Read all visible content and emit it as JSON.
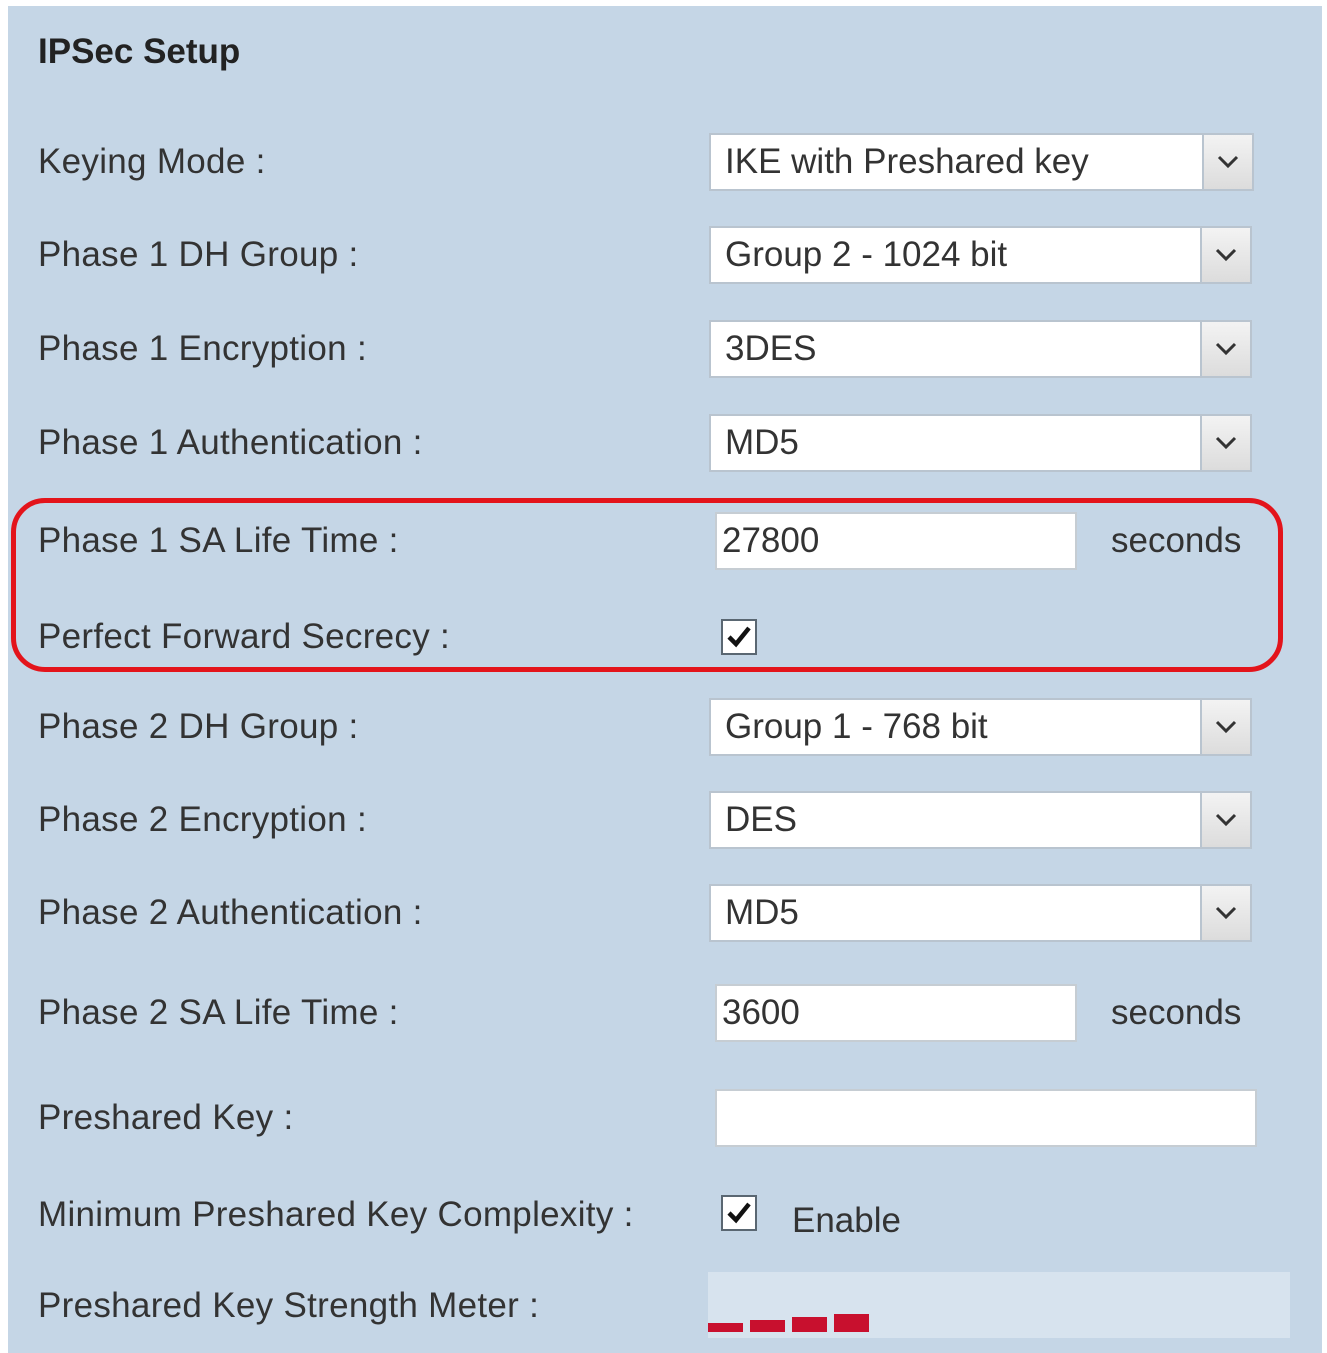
{
  "section_title": "IPSec Setup",
  "fields": {
    "keying_mode": {
      "label": "Keying Mode :",
      "value": "IKE with Preshared key"
    },
    "phase1_dh_group": {
      "label": "Phase 1 DH Group :",
      "value": "Group 2 - 1024 bit"
    },
    "phase1_encryption": {
      "label": "Phase 1 Encryption :",
      "value": "3DES"
    },
    "phase1_authentication": {
      "label": "Phase 1 Authentication :",
      "value": "MD5"
    },
    "phase1_sa_life_time": {
      "label": "Phase 1 SA Life Time :",
      "value": "27800",
      "unit": "seconds"
    },
    "perfect_forward_secrecy": {
      "label": "Perfect Forward Secrecy :",
      "checked": true
    },
    "phase2_dh_group": {
      "label": "Phase 2 DH Group :",
      "value": "Group 1 - 768 bit"
    },
    "phase2_encryption": {
      "label": "Phase 2 Encryption :",
      "value": "DES"
    },
    "phase2_authentication": {
      "label": "Phase 2 Authentication :",
      "value": "MD5"
    },
    "phase2_sa_life_time": {
      "label": "Phase 2 SA Life Time :",
      "value": "3600",
      "unit": "seconds"
    },
    "preshared_key": {
      "label": "Preshared Key :",
      "value": ""
    },
    "min_key_complexity": {
      "label": "Minimum Preshared Key Complexity :",
      "checked": true,
      "option_label": "Enable"
    },
    "strength_meter": {
      "label": "Preshared Key Strength Meter :",
      "filled_segments": 4,
      "color": "#c8102e"
    }
  },
  "colors": {
    "panel_background": "#c5d6e6",
    "highlight_border": "#e3141b"
  },
  "icons": {
    "dropdown": "chevron-down-icon",
    "check": "checkmark-icon"
  }
}
